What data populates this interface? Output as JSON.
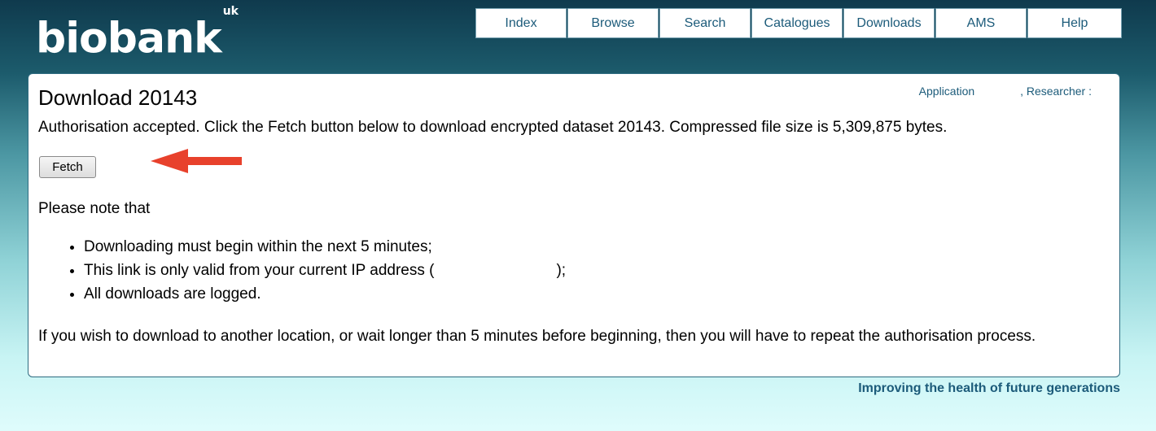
{
  "logo": {
    "text": "biobank",
    "suffix": "uk"
  },
  "nav": {
    "items": [
      {
        "label": "Index"
      },
      {
        "label": "Browse"
      },
      {
        "label": "Search"
      },
      {
        "label": "Catalogues"
      },
      {
        "label": "Downloads"
      },
      {
        "label": "AMS"
      },
      {
        "label": "Help"
      }
    ]
  },
  "page": {
    "title": "Download 20143",
    "links": {
      "application": "Application",
      "researcher": ", Researcher :"
    },
    "message": "Authorisation accepted. Click the Fetch button below to download encrypted dataset 20143. Compressed file size is 5,309,875 bytes.",
    "fetch_label": "Fetch",
    "note": "Please note that",
    "bullets": {
      "b1": "Downloading must begin within the next 5 minutes;",
      "b2_before": "This link is only valid from your current IP address (",
      "b2_after": ");",
      "b3": "All downloads are logged."
    },
    "footnote": "If you wish to download to another location, or wait longer than 5 minutes before beginning, then you will have to repeat the authorisation process."
  },
  "tagline": "Improving the health of future generations",
  "colors": {
    "arrow": "#e8412c",
    "link": "#1c5b7a",
    "header_dark": "#0f3a4d"
  },
  "icons": {
    "pointer": "arrow-left-icon"
  }
}
